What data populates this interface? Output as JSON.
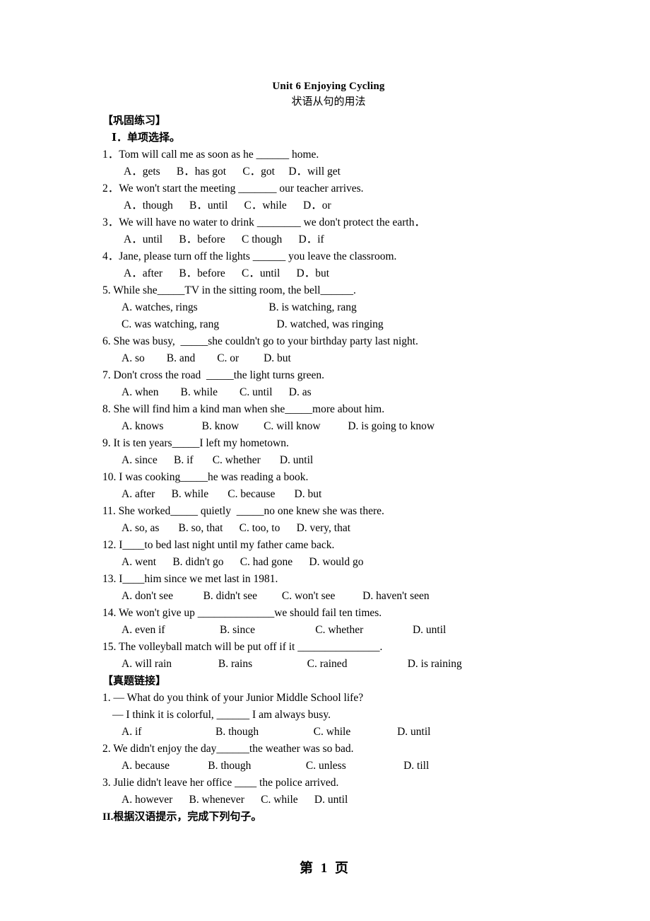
{
  "document": {
    "title": "Unit 6 Enjoying Cycling",
    "subtitle": "状语从句的用法"
  },
  "sections": {
    "practice_header": "【巩固练习】",
    "practice_sub_header": "Ⅰ．单项选择。",
    "exam_link_header": "【真题链接】",
    "translation_header": "II.根据汉语提示，完成下列句子。"
  },
  "multiple_choice": [
    {
      "stem": "1．Tom will call me as soon as he ______ home.",
      "options": "A．gets      B．has got      C．got     D．will get"
    },
    {
      "stem": "2．We won't start the meeting _______ our teacher arrives.",
      "options": "A．though      B．until      C．while      D．or"
    },
    {
      "stem": "3．We will have no water to drink ________ we don't protect the earth．",
      "options": "A．until      B．before      C though      D．if"
    },
    {
      "stem": "4．Jane, please turn off the lights ______ you leave the classroom.",
      "options": "A．after      B．before      C．until      D．but"
    },
    {
      "stem": "5. While she_____TV in the sitting room, the bell______.",
      "options_a": "A. watches, rings                          B. is watching, rang",
      "options_b": "C. was watching, rang                     D. watched, was ringing"
    },
    {
      "stem": "6. She was busy,  _____she couldn't go to your birthday party last night.",
      "options": "A. so        B. and        C. or         D. but"
    },
    {
      "stem": "7. Don't cross the road  _____the light turns green.",
      "options": "A. when        B. while        C. until      D. as"
    },
    {
      "stem": "8. She will find him a kind man when she_____more about him.",
      "options": "A. knows              B. know         C. will know          D. is going to know"
    },
    {
      "stem": "9. It is ten years_____I left my hometown.",
      "options": "A. since      B. if       C. whether       D. until"
    },
    {
      "stem": "10. I was cooking_____he was reading a book.",
      "options": "A. after      B. while       C. because       D. but"
    },
    {
      "stem": "11. She worked_____ quietly  _____no one knew she was there.",
      "options": "A. so, as       B. so, that      C. too, to      D. very, that"
    },
    {
      "stem": "12. I____to bed last night until my father came back.",
      "options": "A. went      B. didn't go      C. had gone      D. would go"
    },
    {
      "stem": "13. I____him since we met last in 1981.",
      "options": "A. don't see           B. didn't see         C. won't see          D. haven't seen"
    },
    {
      "stem": "14. We won't give up ______________we should fail ten times.",
      "options": "A. even if                    B. since                      C. whether                  D. until"
    },
    {
      "stem": "15. The volleyball match will be put off if it _______________.",
      "options": "A. will rain                 B. rains                    C. rained                      D. is raining"
    }
  ],
  "exam_link": [
    {
      "stem": "1. — What do you think of your Junior Middle School life?",
      "stem2": "— I think it is colorful, ______ I am always busy.",
      "options": "A. if                           B. though                    C. while                 D. until"
    },
    {
      "stem": "2. We didn't enjoy the day______the weather was so bad.",
      "options": "A. because              B. though                    C. unless                     D. till"
    },
    {
      "stem": "3. Julie didn't leave her office ____ the police arrived.",
      "options": "A. however      B. whenever      C. while      D. until"
    }
  ],
  "footer": {
    "page_label": "第 1 页"
  }
}
